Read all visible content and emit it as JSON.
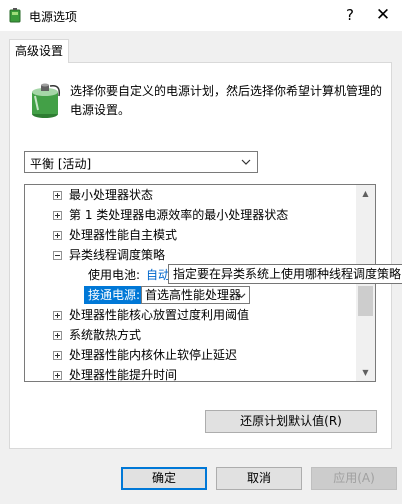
{
  "window": {
    "title": "电源选项",
    "help_label": "?",
    "close_label": "✕"
  },
  "tab": {
    "label": "高级设置"
  },
  "description": "选择你要自定义的电源计划，然后选择你希望计算机管理的电源设置。",
  "plan_select": {
    "value": "平衡 [活动]"
  },
  "tree": {
    "items": [
      {
        "label": "最小处理器状态",
        "expander": "plus"
      },
      {
        "label": "第 1 类处理器电源效率的最小处理器状态",
        "expander": "plus"
      },
      {
        "label": "处理器性能自主模式",
        "expander": "plus"
      },
      {
        "label": "异类线程调度策略",
        "expander": "minus"
      },
      {
        "label": "处理器性能核心放置过度利用阈值",
        "expander": "plus"
      },
      {
        "label": "系统散热方式",
        "expander": "plus"
      },
      {
        "label": "处理器性能内核休止软停止延迟",
        "expander": "plus"
      },
      {
        "label": "处理器性能提升时间",
        "expander": "plus"
      }
    ],
    "sub_battery_label": "使用电池:",
    "sub_battery_value": "自动",
    "sub_ac_label": "接通电源:",
    "sub_ac_value": "首选高性能处理器"
  },
  "tooltip": "指定要在异类系统上使用哪种线程调度策略",
  "buttons": {
    "restore": "还原计划默认值(R)",
    "ok": "确定",
    "cancel": "取消",
    "apply": "应用(A)"
  }
}
